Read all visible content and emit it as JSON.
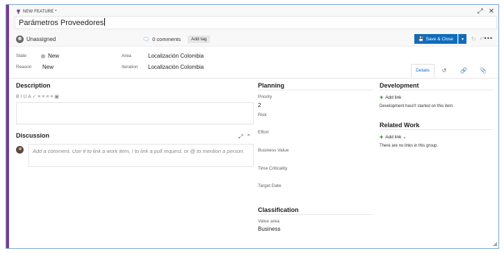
{
  "header": {
    "type_label": "NEW FEATURE *",
    "title": "Parámetros Proveedores",
    "assignee": "Unassigned",
    "comments": "0 comments",
    "add_tag": "Add tag",
    "save_label": "Save & Close"
  },
  "fields": {
    "state_label": "State",
    "state_value": "New",
    "reason_label": "Reason",
    "reason_value": "New",
    "area_label": "Area",
    "area_value": "Localización Colombia",
    "iteration_label": "Iteration",
    "iteration_value": "Localización Colombia"
  },
  "tabs": {
    "details": "Details"
  },
  "description": {
    "title": "Description",
    "toolbar": "B I U A ✓ ≡ ≡ ≡ ≡ ▣"
  },
  "discussion": {
    "title": "Discussion",
    "placeholder": "Add a comment. Use # to link a work item, ! to link a pull request, or @ to mention a person."
  },
  "planning": {
    "title": "Planning",
    "priority_label": "Priority",
    "priority_value": "2",
    "risk_label": "Risk",
    "effort_label": "Effort",
    "business_value_label": "Business Value",
    "time_criticality_label": "Time Criticality",
    "target_date_label": "Target Date"
  },
  "classification": {
    "title": "Classification",
    "value_area_label": "Value area",
    "value_area_value": "Business"
  },
  "development": {
    "title": "Development",
    "add_link": "Add link",
    "note": "Development hasn't started on this item."
  },
  "related_work": {
    "title": "Related Work",
    "add_link": "Add link ⌄",
    "note": "There are no links in this group."
  },
  "colors": {
    "accent": "#773b93",
    "primary": "#0f6cbd",
    "border": "#7aa7d8"
  }
}
